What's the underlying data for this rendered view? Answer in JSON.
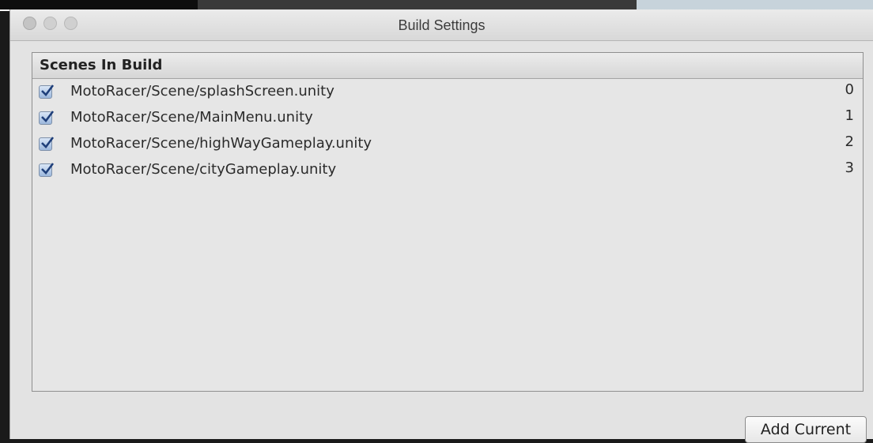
{
  "window": {
    "title": "Build Settings"
  },
  "scenes_panel": {
    "header": "Scenes In Build",
    "scenes": [
      {
        "path": "MotoRacer/Scene/splashScreen.unity",
        "index": "0",
        "checked": true
      },
      {
        "path": "MotoRacer/Scene/MainMenu.unity",
        "index": "1",
        "checked": true
      },
      {
        "path": "MotoRacer/Scene/highWayGameplay.unity",
        "index": "2",
        "checked": true
      },
      {
        "path": "MotoRacer/Scene/cityGameplay.unity",
        "index": "3",
        "checked": true
      }
    ]
  },
  "buttons": {
    "add_current": "Add Current"
  },
  "colors": {
    "checkbox_fill": "#9cb7dc",
    "checkmark": "#1f3f7a",
    "window_bg": "#e3e3e3"
  }
}
